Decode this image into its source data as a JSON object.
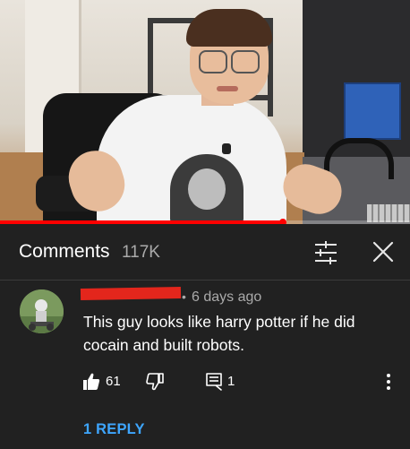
{
  "video": {
    "progress_fraction": 0.69
  },
  "comments_panel": {
    "title": "Comments",
    "count": "117K",
    "sort_icon": "sort-sliders-icon",
    "close_icon": "close-icon"
  },
  "comment": {
    "time_ago": "6 days ago",
    "text": "This guy looks like harry potter if he did cocain and built robots.",
    "like_count": "61",
    "reply_count": "1",
    "replies_link": "1 REPLY",
    "redaction_color": "#e3261c"
  },
  "colors": {
    "background": "#212121",
    "link": "#3ea6ff",
    "secondary_text": "#aaaaaa",
    "progress": "#ff0000"
  }
}
